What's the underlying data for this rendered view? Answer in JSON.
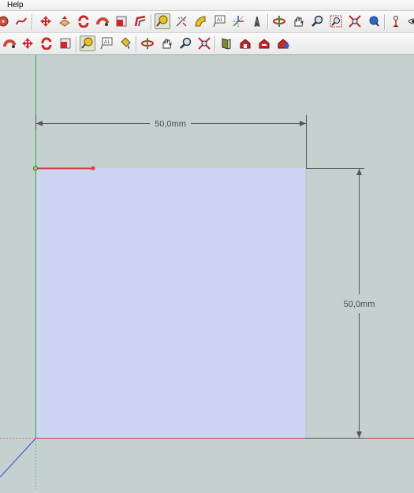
{
  "menu": {
    "help_label": "Help"
  },
  "toolbar_row1": [
    "select-tool-icon",
    "freehand-icon",
    "move-icon",
    "push-pull-icon",
    "rotate-icon",
    "follow-me-icon",
    "scale-icon",
    "offset-icon",
    "tape-measure-icon",
    "dimension-icon",
    "protractor-icon",
    "text-icon",
    "axes-icon",
    "3d-text-icon",
    "orbit-icon",
    "pan-icon",
    "zoom-icon",
    "zoom-window-icon",
    "zoom-extents-icon",
    "position-camera-icon",
    "look-around-icon"
  ],
  "toolbar_row2": [
    "offset-icon",
    "move-icon",
    "rotate-icon",
    "scale-icon",
    "tape-measure-icon",
    "text-icon",
    "paint-bucket-icon",
    "orbit-icon",
    "pan-icon",
    "zoom-icon",
    "zoom-extents-icon",
    "section-plane-icon",
    "warehouse-icon",
    "components-icon",
    "share-model-icon"
  ],
  "viewport": {
    "width_dimension": "50,0mm",
    "height_dimension": "50,0mm",
    "face_color": "#cdd5f2",
    "background_color": "#c5d1d1",
    "red_axis_color": "#d23a3a",
    "green_axis_color": "#3aa83a",
    "blue_axis_color": "#3a4ad2"
  }
}
